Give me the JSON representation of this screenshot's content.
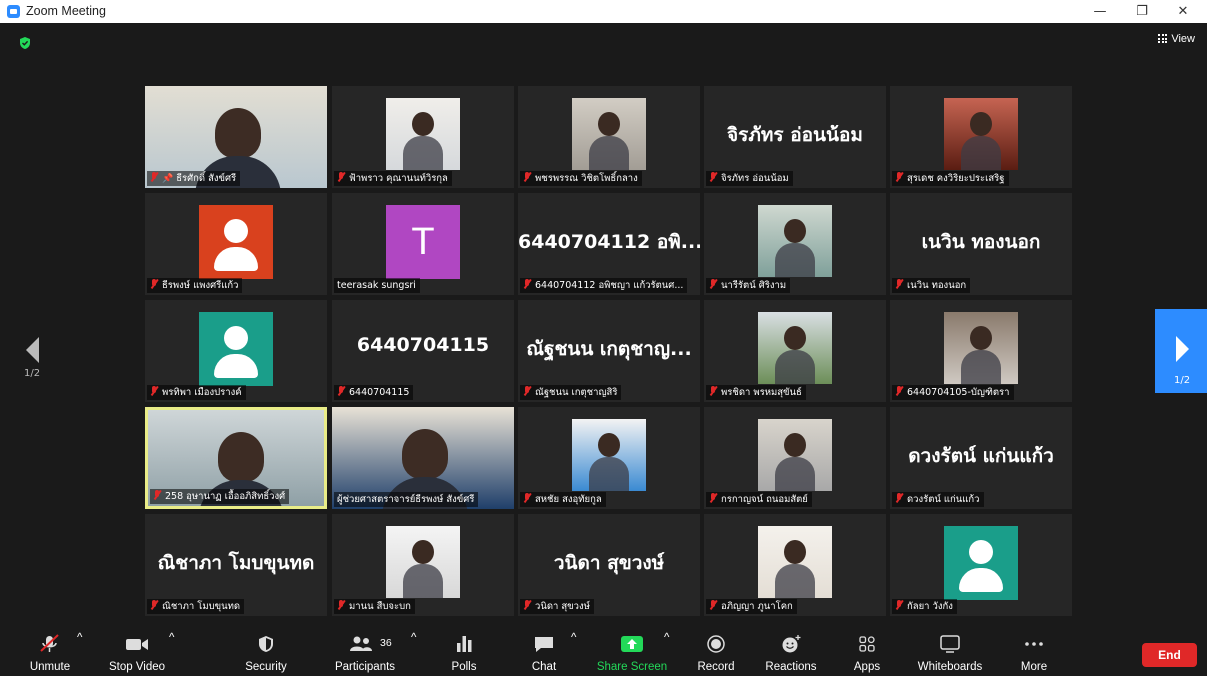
{
  "window": {
    "title": "Zoom Meeting",
    "minimize": "—",
    "restore": "❐",
    "close": "✕"
  },
  "header": {
    "view_label": "View"
  },
  "pager": {
    "left_label": "1/2",
    "right_label": "1/2"
  },
  "tiles": [
    {
      "name": "ธีรศักดิ์ สังข์ศรี",
      "type": "video",
      "pinned": true
    },
    {
      "name": "ฟ้าพราว คุณานนท์วิรกุล",
      "type": "photo"
    },
    {
      "name": "พชรพรรณ วิชิตโพธิ์กลาง",
      "type": "photo"
    },
    {
      "name": "จิรภัทร อ่อนน้อม",
      "big": "จิรภัทร อ่อนน้อม",
      "type": "text"
    },
    {
      "name": "สุรเดช คงวิริยะประเสริฐ",
      "type": "photo"
    },
    {
      "name": "ธีรพงษ์ แพงศรีแก้ว",
      "type": "avatar",
      "avatar_color": "#d9411e"
    },
    {
      "name": "teerasak sungsri",
      "type": "letter",
      "letter": "T",
      "avatar_color": "#b047c2",
      "muted": false
    },
    {
      "name": "6440704112 อพิชญา แก้วรัตนศ...",
      "big": "6440704112 อพิ...",
      "type": "text"
    },
    {
      "name": "นารีรัตน์ ศิริงาม",
      "type": "photo"
    },
    {
      "name": "เนวิน ทองนอก",
      "big": "เนวิน ทองนอก",
      "type": "text"
    },
    {
      "name": "พรทิพา เมืองปรางค์",
      "type": "avatar",
      "avatar_color": "#1a9e8a"
    },
    {
      "name": "6440704115",
      "big": "6440704115",
      "type": "text"
    },
    {
      "name": "ณัฐชนน เกตุชาญสิริ",
      "big": "ณัฐชนน เกตุชาญ...",
      "type": "text"
    },
    {
      "name": "พรชิดา พรหมสุขันธ์",
      "type": "photo"
    },
    {
      "name": "6440704105-บัญฑิตรา",
      "type": "photo"
    },
    {
      "name": "258 อุษานาฏ เอื้ออภิสิทธิ์วงศ์",
      "type": "video",
      "active": true
    },
    {
      "name": "ผู้ช่วยศาสตราจารย์ธีรพงษ์ สังข์ศรี",
      "type": "video",
      "muted": false
    },
    {
      "name": "สหชัย สงอุทัยกูล",
      "type": "photo"
    },
    {
      "name": "กรกาญจน์ ถนอมสัตย์",
      "type": "photo"
    },
    {
      "name": "ดวงรัตน์ แก่นแก้ว",
      "big": "ดวงรัตน์ แก่นแก้ว",
      "type": "text"
    },
    {
      "name": "ณิชาภา โมบขุนทด",
      "big": "ณิชาภา โมบขุนทด",
      "type": "text"
    },
    {
      "name": "มานน สืบจะบก",
      "type": "photo"
    },
    {
      "name": "วนิดา สุขวงษ์",
      "big": "วนิดา สุขวงษ์",
      "type": "text"
    },
    {
      "name": "อภิญญา ภูนาโคก",
      "type": "photo"
    },
    {
      "name": "กัลยา วังกัง",
      "type": "avatar",
      "avatar_color": "#1a9e8a"
    }
  ],
  "toolbar": {
    "unmute": "Unmute",
    "stop_video": "Stop Video",
    "security": "Security",
    "participants": "Participants",
    "participants_count": "36",
    "polls": "Polls",
    "chat": "Chat",
    "share_screen": "Share Screen",
    "record": "Record",
    "reactions": "Reactions",
    "apps": "Apps",
    "whiteboards": "Whiteboards",
    "more": "More",
    "end": "End"
  },
  "colors": {
    "accent": "#2d8cff",
    "end": "#e02828",
    "share": "#23d959",
    "active_border": "#e9ec88"
  }
}
